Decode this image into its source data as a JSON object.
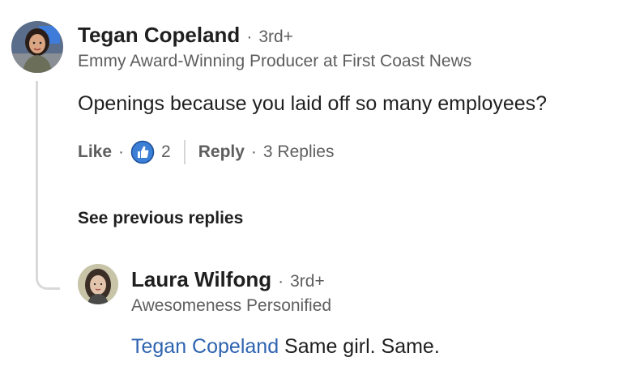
{
  "comment": {
    "author": "Tegan Copeland",
    "degree": "3rd+",
    "headline": "Emmy Award-Winning Producer at First Coast News",
    "text": "Openings because you laid off so many employees?",
    "like_label": "Like",
    "reaction_count": "2",
    "reply_label": "Reply",
    "replies_count": "3 Replies"
  },
  "see_previous_label": "See previous replies",
  "reply": {
    "author": "Laura Wilfong",
    "degree": "3rd+",
    "headline": "Awesomeness Personified",
    "mention": "Tegan Copeland",
    "text": "Same girl. Same."
  },
  "separator": "·",
  "colors": {
    "mention": "#2f64b0",
    "like_icon": "#3b7fd6",
    "thread_line": "#d9d9d9"
  }
}
